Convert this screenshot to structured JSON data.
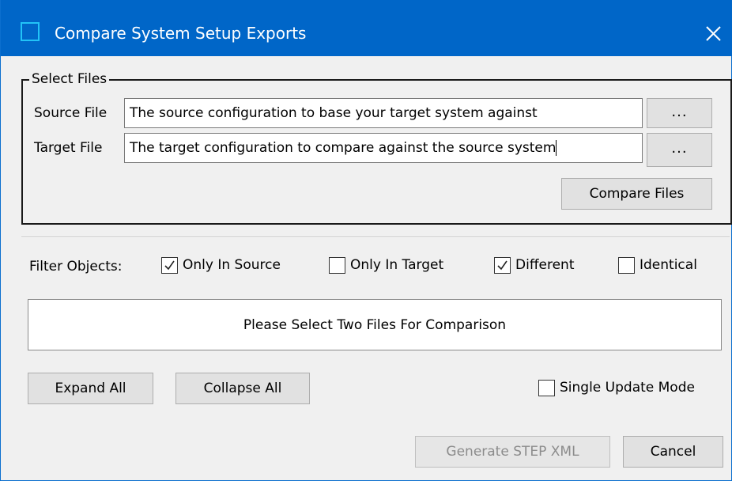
{
  "window": {
    "title": "Compare System Setup Exports",
    "icons": {
      "app": "window-app-icon",
      "close": "close-icon"
    }
  },
  "select_files": {
    "legend": "Select Files",
    "source": {
      "label": "Source File",
      "value": "The source configuration to base your target system against",
      "browse_label": "..."
    },
    "target": {
      "label": "Target File",
      "value": "The target configuration to compare against the source system",
      "browse_label": "..."
    },
    "compare_button": "Compare Files"
  },
  "filter": {
    "label": "Filter Objects:",
    "options": [
      {
        "label": "Only In Source",
        "checked": true
      },
      {
        "label": "Only In Target",
        "checked": false
      },
      {
        "label": "Different",
        "checked": true
      },
      {
        "label": "Identical",
        "checked": false
      }
    ]
  },
  "results": {
    "message": "Please Select Two Files For Comparison"
  },
  "actions": {
    "expand_all": "Expand All",
    "collapse_all": "Collapse All",
    "single_update_mode": {
      "label": "Single Update Mode",
      "checked": false
    },
    "generate": {
      "label": "Generate STEP XML",
      "enabled": false
    },
    "cancel": "Cancel"
  },
  "colors": {
    "titlebar": "#0066c8",
    "app_icon": "#22c3f7",
    "window_bg": "#f0f0f0",
    "button_bg": "#e1e1e1"
  }
}
